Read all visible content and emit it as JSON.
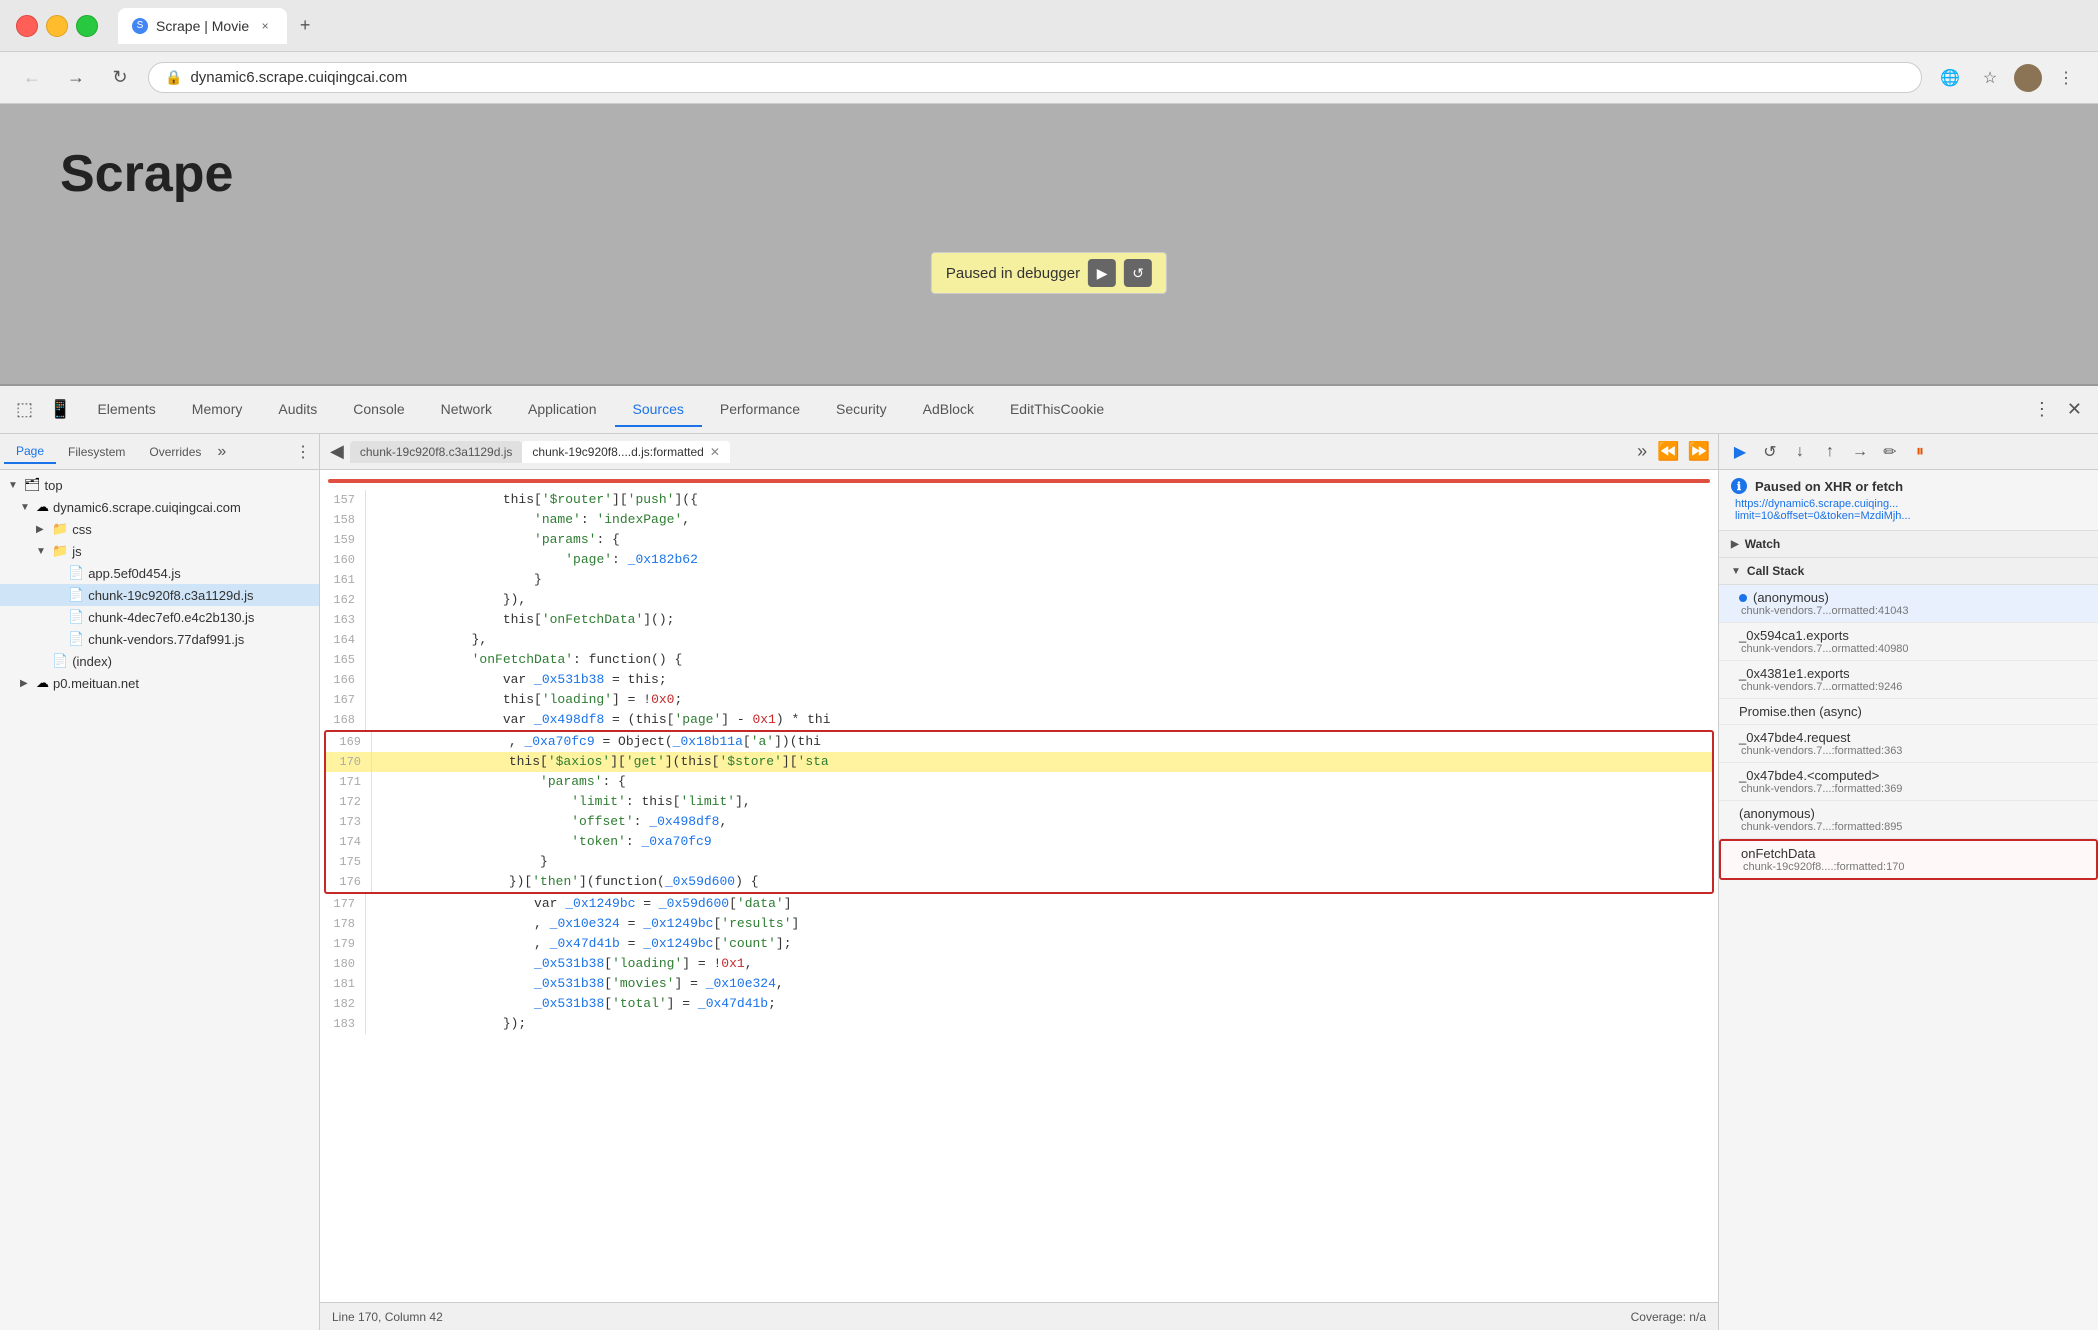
{
  "browser": {
    "tab_label": "Scrape | Movie",
    "tab_close": "×",
    "new_tab": "+",
    "url": "dynamic6.scrape.cuiqingcai.com",
    "back_btn": "←",
    "forward_btn": "→",
    "close_btn": "✕",
    "refresh_btn": "↻",
    "bookmark_icon": "☆",
    "more_icon": "⋮"
  },
  "page": {
    "title": "Scrape",
    "debugger_label": "Paused in debugger"
  },
  "devtools": {
    "tabs": [
      {
        "label": "Elements",
        "active": false
      },
      {
        "label": "Memory",
        "active": false
      },
      {
        "label": "Audits",
        "active": false
      },
      {
        "label": "Console",
        "active": false
      },
      {
        "label": "Network",
        "active": false
      },
      {
        "label": "Application",
        "active": false
      },
      {
        "label": "Sources",
        "active": true
      },
      {
        "label": "Performance",
        "active": false
      },
      {
        "label": "Security",
        "active": false
      },
      {
        "label": "AdBlock",
        "active": false
      },
      {
        "label": "EditThisCookie",
        "active": false
      }
    ]
  },
  "sources": {
    "tabs": [
      "Page",
      "Filesystem",
      "Overrides"
    ],
    "active_tab": "Page",
    "file_tree": [
      {
        "indent": 0,
        "type": "folder",
        "label": "top",
        "expanded": true
      },
      {
        "indent": 1,
        "type": "folder",
        "label": "dynamic6.scrape.cuiqingcai.com",
        "expanded": true
      },
      {
        "indent": 2,
        "type": "folder",
        "label": "css",
        "expanded": false
      },
      {
        "indent": 2,
        "type": "folder",
        "label": "js",
        "expanded": true
      },
      {
        "indent": 3,
        "type": "file",
        "label": "app.5ef0d454.js"
      },
      {
        "indent": 3,
        "type": "file",
        "label": "chunk-19c920f8.c3a1129d.js",
        "selected": true
      },
      {
        "indent": 3,
        "type": "file",
        "label": "chunk-4dec7ef0.e4c2b130.js"
      },
      {
        "indent": 3,
        "type": "file",
        "label": "chunk-vendors.77daf991.js"
      },
      {
        "indent": 2,
        "type": "file",
        "label": "(index)"
      },
      {
        "indent": 1,
        "type": "folder",
        "label": "p0.meituan.net",
        "expanded": false
      }
    ]
  },
  "editor": {
    "tabs": [
      {
        "label": "chunk-19c920f8.c3a1129d.js",
        "active": false
      },
      {
        "label": "chunk-19c920f8....d.js:formatted",
        "active": true
      }
    ],
    "lines": [
      {
        "num": 157,
        "tokens": [
          {
            "text": "                this[",
            "cls": "c-dark"
          },
          {
            "text": "'$router'",
            "cls": "c-string"
          },
          {
            "text": "][",
            "cls": "c-dark"
          },
          {
            "text": "'push'",
            "cls": "c-string"
          },
          {
            "text": "]({",
            "cls": "c-dark"
          }
        ]
      },
      {
        "num": 158,
        "tokens": [
          {
            "text": "                    ",
            "cls": "c-dark"
          },
          {
            "text": "'name'",
            "cls": "c-string"
          },
          {
            "text": ": ",
            "cls": "c-dark"
          },
          {
            "text": "'indexPage'",
            "cls": "c-string"
          },
          {
            "text": ",",
            "cls": "c-dark"
          }
        ]
      },
      {
        "num": 159,
        "tokens": [
          {
            "text": "                    ",
            "cls": "c-dark"
          },
          {
            "text": "'params'",
            "cls": "c-string"
          },
          {
            "text": ": {",
            "cls": "c-dark"
          }
        ]
      },
      {
        "num": 160,
        "tokens": [
          {
            "text": "                        ",
            "cls": "c-dark"
          },
          {
            "text": "'page'",
            "cls": "c-string"
          },
          {
            "text": ": ",
            "cls": "c-dark"
          },
          {
            "text": "_0x182b62",
            "cls": "c-blue"
          }
        ]
      },
      {
        "num": 161,
        "tokens": [
          {
            "text": "                    }",
            "cls": "c-dark"
          }
        ]
      },
      {
        "num": 162,
        "tokens": [
          {
            "text": "                }),",
            "cls": "c-dark"
          }
        ]
      },
      {
        "num": 163,
        "tokens": [
          {
            "text": "                this[",
            "cls": "c-dark"
          },
          {
            "text": "'onFetchData'",
            "cls": "c-string"
          },
          {
            "text": "]();",
            "cls": "c-dark"
          }
        ]
      },
      {
        "num": 164,
        "tokens": [
          {
            "text": "            },",
            "cls": "c-dark"
          }
        ]
      },
      {
        "num": 165,
        "tokens": [
          {
            "text": "            ",
            "cls": "c-dark"
          },
          {
            "text": "'onFetchData'",
            "cls": "c-string"
          },
          {
            "text": ": function() {",
            "cls": "c-dark"
          }
        ]
      },
      {
        "num": 166,
        "tokens": [
          {
            "text": "                var ",
            "cls": "c-dark"
          },
          {
            "text": "_0x531b38",
            "cls": "c-blue"
          },
          {
            "text": " = this;",
            "cls": "c-dark"
          }
        ]
      },
      {
        "num": 167,
        "tokens": [
          {
            "text": "                this[",
            "cls": "c-dark"
          },
          {
            "text": "'loading'",
            "cls": "c-string"
          },
          {
            "text": "] = !",
            "cls": "c-dark"
          },
          {
            "text": "0x0",
            "cls": "c-red"
          },
          {
            "text": ";",
            "cls": "c-dark"
          }
        ]
      },
      {
        "num": 168,
        "tokens": [
          {
            "text": "                var ",
            "cls": "c-dark"
          },
          {
            "text": "_0x498df8",
            "cls": "c-blue"
          },
          {
            "text": " = (this[",
            "cls": "c-dark"
          },
          {
            "text": "'page'",
            "cls": "c-string"
          },
          {
            "text": "] - ",
            "cls": "c-dark"
          },
          {
            "text": "0x1",
            "cls": "c-red"
          },
          {
            "text": ") * thi",
            "cls": "c-dark"
          }
        ]
      },
      {
        "num": 169,
        "tokens": [
          {
            "text": "                , ",
            "cls": "c-dark"
          },
          {
            "text": "_0xa70fc9",
            "cls": "c-blue"
          },
          {
            "text": " = Object(",
            "cls": "c-dark"
          },
          {
            "text": "_0x18b11a",
            "cls": "c-blue"
          },
          {
            "text": "[",
            "cls": "c-dark"
          },
          {
            "text": "'a'",
            "cls": "c-string"
          },
          {
            "text": "])(thi",
            "cls": "c-dark"
          }
        ],
        "highlighted": false,
        "in_box": true
      },
      {
        "num": 170,
        "tokens": [
          {
            "text": "                this[",
            "cls": "c-dark"
          },
          {
            "text": "'$axios'",
            "cls": "c-string"
          },
          {
            "text": "][",
            "cls": "c-dark"
          },
          {
            "text": "'get'",
            "cls": "c-string"
          },
          {
            "text": "](this[",
            "cls": "c-dark"
          },
          {
            "text": "'$store'",
            "cls": "c-string"
          },
          {
            "text": "][",
            "cls": "c-dark"
          },
          {
            "text": "'sta",
            "cls": "c-string"
          }
        ],
        "highlighted": true,
        "in_box": true
      },
      {
        "num": 171,
        "tokens": [
          {
            "text": "                    ",
            "cls": "c-dark"
          },
          {
            "text": "'params'",
            "cls": "c-string"
          },
          {
            "text": ": {",
            "cls": "c-dark"
          }
        ],
        "in_box": true
      },
      {
        "num": 172,
        "tokens": [
          {
            "text": "                        ",
            "cls": "c-dark"
          },
          {
            "text": "'limit'",
            "cls": "c-string"
          },
          {
            "text": ": this[",
            "cls": "c-dark"
          },
          {
            "text": "'limit'",
            "cls": "c-string"
          },
          {
            "text": "],",
            "cls": "c-dark"
          }
        ],
        "in_box": true
      },
      {
        "num": 173,
        "tokens": [
          {
            "text": "                        ",
            "cls": "c-dark"
          },
          {
            "text": "'offset'",
            "cls": "c-string"
          },
          {
            "text": ": ",
            "cls": "c-dark"
          },
          {
            "text": "_0x498df8",
            "cls": "c-blue"
          },
          {
            "text": ",",
            "cls": "c-dark"
          }
        ],
        "in_box": true
      },
      {
        "num": 174,
        "tokens": [
          {
            "text": "                        ",
            "cls": "c-dark"
          },
          {
            "text": "'token'",
            "cls": "c-string"
          },
          {
            "text": ": ",
            "cls": "c-dark"
          },
          {
            "text": "_0xa70fc9",
            "cls": "c-blue"
          }
        ],
        "in_box": true
      },
      {
        "num": 175,
        "tokens": [
          {
            "text": "                    }",
            "cls": "c-dark"
          }
        ],
        "in_box": true
      },
      {
        "num": 176,
        "tokens": [
          {
            "text": "                })[",
            "cls": "c-dark"
          },
          {
            "text": "'then'",
            "cls": "c-string"
          },
          {
            "text": "](function(",
            "cls": "c-dark"
          },
          {
            "text": "_0x59d600",
            "cls": "c-blue"
          },
          {
            "text": ") {",
            "cls": "c-dark"
          }
        ],
        "in_box": true
      },
      {
        "num": 177,
        "tokens": [
          {
            "text": "                    var ",
            "cls": "c-dark"
          },
          {
            "text": "_0x1249bc",
            "cls": "c-blue"
          },
          {
            "text": " = ",
            "cls": "c-dark"
          },
          {
            "text": "_0x59d600",
            "cls": "c-blue"
          },
          {
            "text": "[",
            "cls": "c-dark"
          },
          {
            "text": "'data'",
            "cls": "c-string"
          },
          {
            "text": "]",
            "cls": "c-dark"
          }
        ]
      },
      {
        "num": 178,
        "tokens": [
          {
            "text": "                    , ",
            "cls": "c-dark"
          },
          {
            "text": "_0x10e324",
            "cls": "c-blue"
          },
          {
            "text": " = ",
            "cls": "c-dark"
          },
          {
            "text": "_0x1249bc",
            "cls": "c-blue"
          },
          {
            "text": "[",
            "cls": "c-dark"
          },
          {
            "text": "'results'",
            "cls": "c-string"
          },
          {
            "text": "]",
            "cls": "c-dark"
          }
        ]
      },
      {
        "num": 179,
        "tokens": [
          {
            "text": "                    , ",
            "cls": "c-dark"
          },
          {
            "text": "_0x47d41b",
            "cls": "c-blue"
          },
          {
            "text": " = ",
            "cls": "c-dark"
          },
          {
            "text": "_0x1249bc",
            "cls": "c-blue"
          },
          {
            "text": "[",
            "cls": "c-dark"
          },
          {
            "text": "'count'",
            "cls": "c-string"
          },
          {
            "text": "];",
            "cls": "c-dark"
          }
        ]
      },
      {
        "num": 180,
        "tokens": [
          {
            "text": "                    ",
            "cls": "c-dark"
          },
          {
            "text": "_0x531b38",
            "cls": "c-blue"
          },
          {
            "text": "[",
            "cls": "c-dark"
          },
          {
            "text": "'loading'",
            "cls": "c-string"
          },
          {
            "text": "] = !",
            "cls": "c-dark"
          },
          {
            "text": "0x1",
            "cls": "c-red"
          },
          {
            "text": ",",
            "cls": "c-dark"
          }
        ]
      },
      {
        "num": 181,
        "tokens": [
          {
            "text": "                    ",
            "cls": "c-dark"
          },
          {
            "text": "_0x531b38",
            "cls": "c-blue"
          },
          {
            "text": "[",
            "cls": "c-dark"
          },
          {
            "text": "'movies'",
            "cls": "c-string"
          },
          {
            "text": "] = ",
            "cls": "c-dark"
          },
          {
            "text": "_0x10e324",
            "cls": "c-blue"
          },
          {
            "text": ",",
            "cls": "c-dark"
          }
        ]
      },
      {
        "num": 182,
        "tokens": [
          {
            "text": "                    ",
            "cls": "c-dark"
          },
          {
            "text": "_0x531b38",
            "cls": "c-blue"
          },
          {
            "text": "[",
            "cls": "c-dark"
          },
          {
            "text": "'total'",
            "cls": "c-string"
          },
          {
            "text": "] = ",
            "cls": "c-dark"
          },
          {
            "text": "_0x47d41b",
            "cls": "c-blue"
          },
          {
            "text": ";",
            "cls": "c-dark"
          }
        ]
      },
      {
        "num": 183,
        "tokens": [
          {
            "text": "                });",
            "cls": "c-dark"
          }
        ]
      }
    ],
    "status": {
      "position": "Line 170, Column 42",
      "coverage": "Coverage: n/a"
    }
  },
  "debugger": {
    "paused_title": "Paused on XHR or fetch",
    "paused_url": "https://dynamic6.scrape.cuiqing...\nlimit=10&offset=0&token=MzdiMjh...",
    "watch_label": "Watch",
    "callstack_label": "Call Stack",
    "callstack_items": [
      {
        "name": "(anonymous)",
        "file": "chunk-vendors.7...ormatted:41043",
        "active": true,
        "dot": true
      },
      {
        "name": "_0x594ca1.exports",
        "file": "chunk-vendors.7...ormatted:40980",
        "active": false
      },
      {
        "name": "_0x4381e1.exports",
        "file": "chunk-vendors.7...ormatted:9246",
        "active": false
      },
      {
        "name": "Promise.then (async)",
        "file": "",
        "active": false
      },
      {
        "name": "_0x47bde4.request",
        "file": "chunk-vendors.7...:formatted:363",
        "active": false
      },
      {
        "name": "_0x47bde4.<computed>",
        "file": "chunk-vendors.7...:formatted:369",
        "active": false
      },
      {
        "name": "(anonymous)",
        "file": "chunk-vendors.7...:formatted:895",
        "active": false
      },
      {
        "name": "onFetchData",
        "file": "chunk-19c920f8....:formatted:170",
        "active": false,
        "highlighted": true
      }
    ]
  }
}
